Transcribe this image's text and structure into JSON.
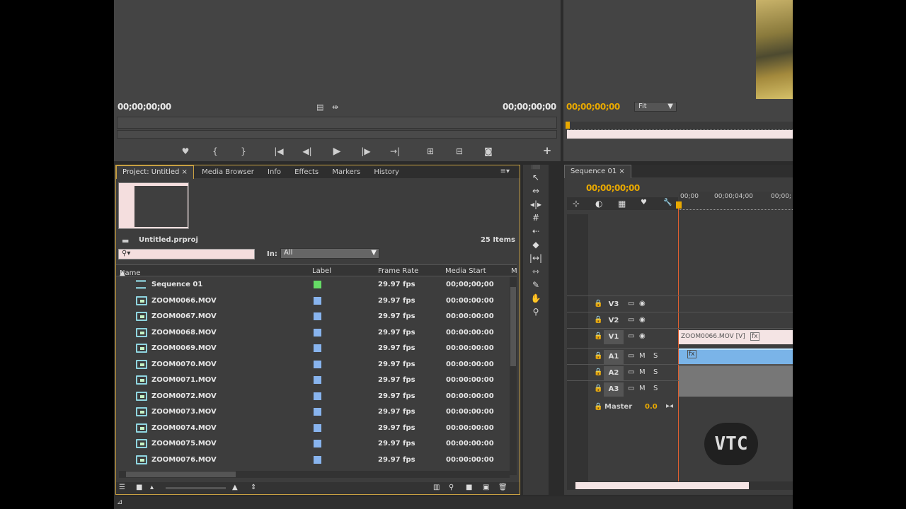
{
  "source_monitor": {
    "timecode_in": "00;00;00;00",
    "timecode_out": "00;00;00;00",
    "controls": [
      "marker-icon",
      "mark-in-icon",
      "mark-out-icon",
      "go-to-in-icon",
      "step-back-icon",
      "play-icon",
      "step-forward-icon",
      "go-to-out-icon",
      "insert-icon",
      "overwrite-icon",
      "export-frame-icon",
      "add-button-icon"
    ]
  },
  "program_monitor": {
    "timecode": "00;00;00;00",
    "zoom": "Fit"
  },
  "project_panel": {
    "tabs": [
      "Project: Untitled",
      "Media Browser",
      "Info",
      "Effects",
      "Markers",
      "History"
    ],
    "project_file": "Untitled.prproj",
    "item_count": "25 Items",
    "search_placeholder": "",
    "in_label": "In:",
    "in_value": "All",
    "columns": [
      "Name",
      "Label",
      "Frame Rate",
      "Media Start",
      "M"
    ],
    "rows": [
      {
        "name": "Sequence 01",
        "label_color": "#66dd66",
        "fps": "29.97 fps",
        "start": "00;00;00;00",
        "type": "sequence"
      },
      {
        "name": "ZOOM0066.MOV",
        "label_color": "#88b4ee",
        "fps": "29.97 fps",
        "start": "00:00:00:00",
        "type": "clip"
      },
      {
        "name": "ZOOM0067.MOV",
        "label_color": "#88b4ee",
        "fps": "29.97 fps",
        "start": "00:00:00:00",
        "type": "clip"
      },
      {
        "name": "ZOOM0068.MOV",
        "label_color": "#88b4ee",
        "fps": "29.97 fps",
        "start": "00:00:00:00",
        "type": "clip"
      },
      {
        "name": "ZOOM0069.MOV",
        "label_color": "#88b4ee",
        "fps": "29.97 fps",
        "start": "00:00:00:00",
        "type": "clip"
      },
      {
        "name": "ZOOM0070.MOV",
        "label_color": "#88b4ee",
        "fps": "29.97 fps",
        "start": "00:00:00:00",
        "type": "clip"
      },
      {
        "name": "ZOOM0071.MOV",
        "label_color": "#88b4ee",
        "fps": "29.97 fps",
        "start": "00:00:00:00",
        "type": "clip"
      },
      {
        "name": "ZOOM0072.MOV",
        "label_color": "#88b4ee",
        "fps": "29.97 fps",
        "start": "00:00:00:00",
        "type": "clip"
      },
      {
        "name": "ZOOM0073.MOV",
        "label_color": "#88b4ee",
        "fps": "29.97 fps",
        "start": "00:00:00:00",
        "type": "clip"
      },
      {
        "name": "ZOOM0074.MOV",
        "label_color": "#88b4ee",
        "fps": "29.97 fps",
        "start": "00:00:00:00",
        "type": "clip"
      },
      {
        "name": "ZOOM0075.MOV",
        "label_color": "#88b4ee",
        "fps": "29.97 fps",
        "start": "00:00:00:00",
        "type": "clip"
      },
      {
        "name": "ZOOM0076.MOV",
        "label_color": "#88b4ee",
        "fps": "29.97 fps",
        "start": "00:00:00:00",
        "type": "clip"
      }
    ]
  },
  "timeline": {
    "tab": "Sequence 01",
    "timecode": "00;00;00;00",
    "ruler": [
      "00;00",
      "00;00;04;00",
      "00;00;"
    ],
    "tracks": [
      {
        "name": "V3"
      },
      {
        "name": "V2"
      },
      {
        "name": "V1"
      },
      {
        "name": "A1"
      },
      {
        "name": "A2"
      },
      {
        "name": "A3"
      }
    ],
    "master_label": "Master",
    "master_value": "0.0",
    "clip_label": "ZOOM0066.MOV [V]",
    "watermark": "VTC"
  },
  "colors": {
    "accent": "#e9a900",
    "panel": "#3d3d3d",
    "border_active": "#c8a042"
  }
}
